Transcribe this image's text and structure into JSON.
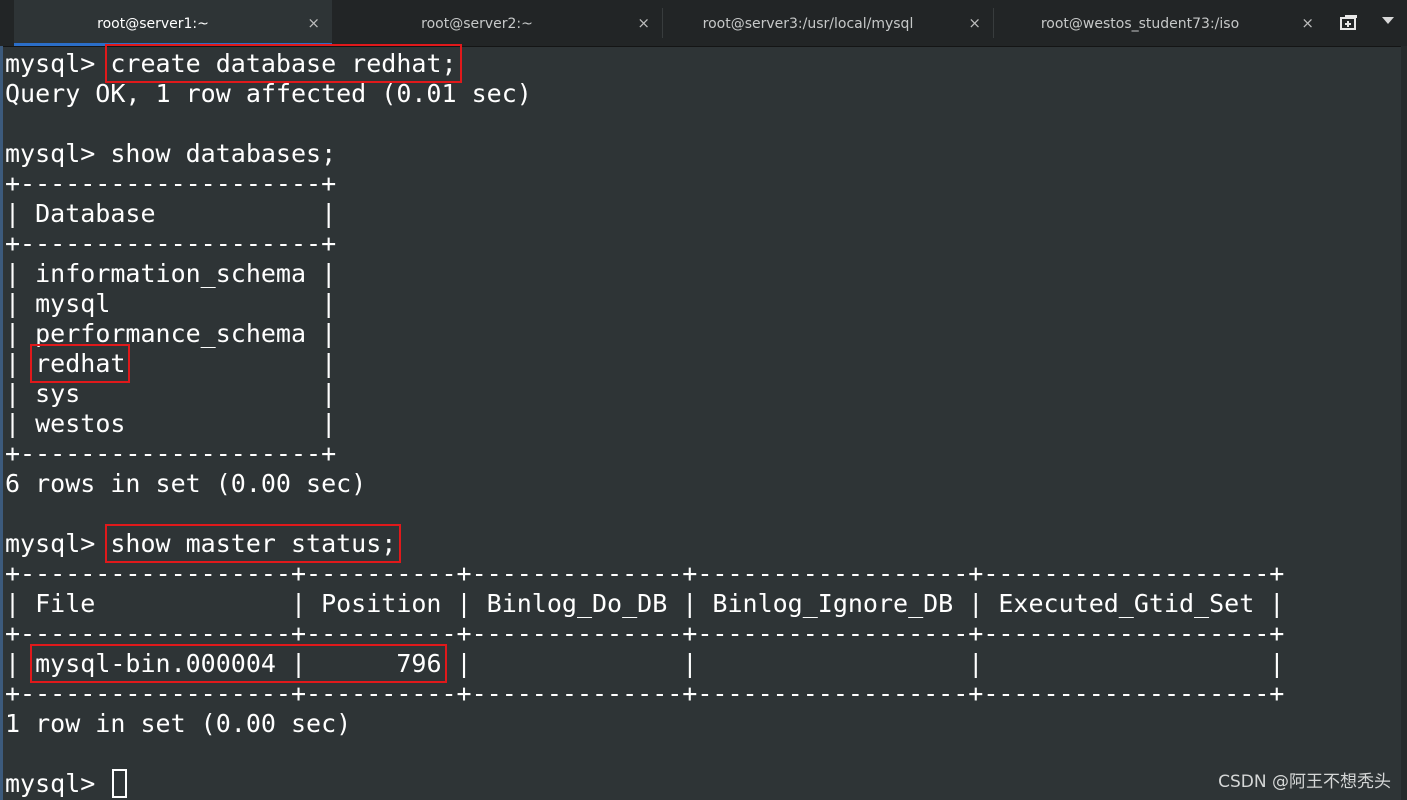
{
  "tabs": [
    {
      "title": "root@server1:~",
      "close": "×"
    },
    {
      "title": "root@server2:~",
      "close": "×"
    },
    {
      "title": "root@server3:/usr/local/mysql",
      "close": "×"
    },
    {
      "title": "root@westos_student73:/iso",
      "close": "×"
    }
  ],
  "active_tab": 0,
  "icons": {
    "new_tab": "new-tab-icon",
    "menu": "chevron-down-icon"
  },
  "colors": {
    "background": "#2e3436",
    "text": "#ffffff",
    "highlight": "#e0191b",
    "tab_indicator": "#2b6ec8"
  },
  "terminal": {
    "prompt": "mysql> ",
    "cmd1": "create database redhat;",
    "out1": "Query OK, 1 row affected (0.01 sec)",
    "cmd2": "show databases;",
    "db_border": "+--------------------+",
    "db_header": "| Database           |",
    "db_pipe": "| ",
    "db_rows": [
      {
        "name": "information_schema",
        "pad": " |"
      },
      {
        "name": "mysql",
        "pad": "              |"
      },
      {
        "name": "performance_schema",
        "pad": " |"
      },
      {
        "name": "redhat",
        "pad": "             |"
      },
      {
        "name": "sys",
        "pad": "                |"
      },
      {
        "name": "westos",
        "pad": "             |"
      }
    ],
    "out2": "6 rows in set (0.00 sec)",
    "cmd3": "show master status;",
    "ms_border": "+------------------+----------+--------------+------------------+-------------------+",
    "ms_header": "| File             | Position | Binlog_Do_DB | Binlog_Ignore_DB | Executed_Gtid_Set |",
    "ms_row_start": "| ",
    "ms_row_value": "mysql-bin.000004 |      796",
    "ms_row_end": " |              |                  |                   |",
    "out3": "1 row in set (0.00 sec)"
  },
  "watermark": "CSDN @阿王不想秃头"
}
